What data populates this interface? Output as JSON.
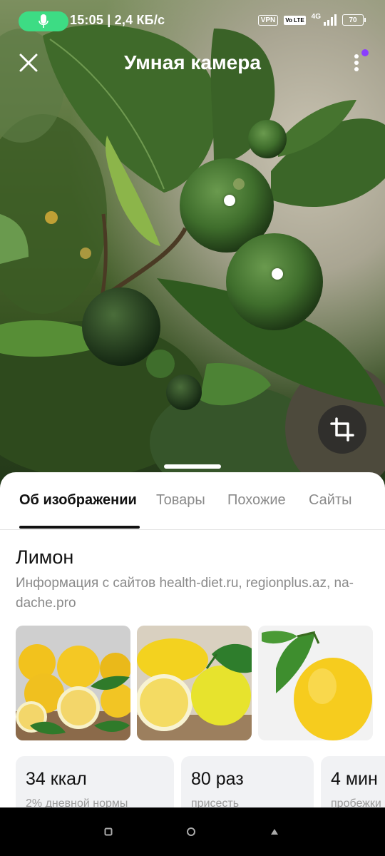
{
  "status_bar": {
    "time": "15:05 | 2,4 КБ/с",
    "vpn": "VPN",
    "volte": "Vo LTE",
    "network": "4G",
    "battery": "70"
  },
  "header": {
    "title": "Умная камера",
    "notification_color": "#8a3dff"
  },
  "tabs": [
    {
      "label": "Об изображении",
      "active": true
    },
    {
      "label": "Товары",
      "active": false
    },
    {
      "label": "Похожие",
      "active": false
    },
    {
      "label": "Сайты",
      "active": false
    }
  ],
  "result": {
    "title": "Лимон",
    "source": "Информация с сайтов health-diet.ru, regionplus.az, na-dache.pro"
  },
  "thumbnails": [
    {
      "icon": "lemons-on-board-image"
    },
    {
      "icon": "sliced-lemon-image"
    },
    {
      "icon": "lemon-with-leaves-image"
    }
  ],
  "facts": [
    {
      "value": "34 ккал",
      "sub": "2% дневной нормы"
    },
    {
      "value": "80 раз",
      "sub": "присесть"
    },
    {
      "value": "4 мин",
      "sub": "пробежки"
    }
  ],
  "colors": {
    "mic_pill": "#3ddc84",
    "accent_underline": "#111111"
  }
}
